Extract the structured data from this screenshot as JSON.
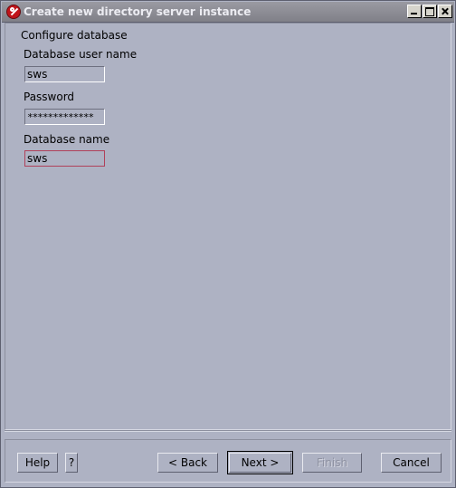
{
  "window": {
    "title": "Create new directory server instance",
    "controls": {
      "minimize_icon": "minimize-icon",
      "maximize_icon": "maximize-icon",
      "close_icon": "close-icon"
    },
    "app_icon": "red-wrench-icon"
  },
  "form": {
    "section_title": "Configure database",
    "user_label": "Database user name",
    "user_value": "sws",
    "password_label": "Password",
    "password_value": "*************",
    "dbname_label": "Database name",
    "dbname_value": "sws"
  },
  "buttons": {
    "help": "Help",
    "question": "?",
    "back": "< Back",
    "next": "Next >",
    "finish": "Finish",
    "cancel": "Cancel"
  }
}
